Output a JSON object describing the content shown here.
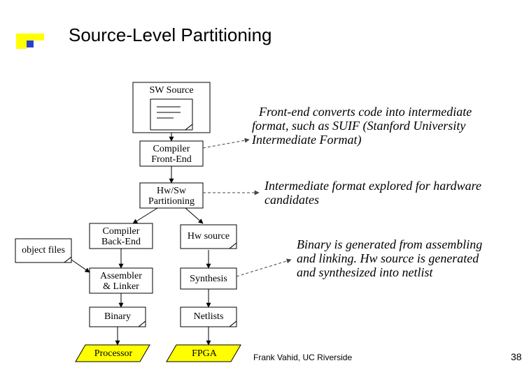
{
  "title": "Source-Level Partitioning",
  "nodes": {
    "sw_source": "SW Source",
    "compiler_fe": {
      "l1": "Compiler",
      "l2": "Front-End"
    },
    "hwsw_part": {
      "l1": "Hw/Sw",
      "l2": "Partitioning"
    },
    "compiler_be": {
      "l1": "Compiler",
      "l2": "Back-End"
    },
    "object_files": "object files",
    "assembler": {
      "l1": "Assembler",
      "l2": "& Linker"
    },
    "hw_source": "Hw source",
    "synthesis": "Synthesis",
    "binary": "Binary",
    "netlists": "Netlists",
    "processor": "Processor",
    "fpga": "FPGA"
  },
  "notes": {
    "n1": {
      "l1": "Front-end converts code into intermediate",
      "l2": "format, such as SUIF (Stanford University",
      "l3": "Intermediate Format)"
    },
    "n2": {
      "l1": "Intermediate format explored  for hardware",
      "l2": "candidates"
    },
    "n3": {
      "l1": "Binary is generated from assembling",
      "l2": "and linking.  Hw source is generated",
      "l3": "and synthesized into netlist"
    }
  },
  "credit": "Frank Vahid, UC Riverside",
  "page_no": "38"
}
